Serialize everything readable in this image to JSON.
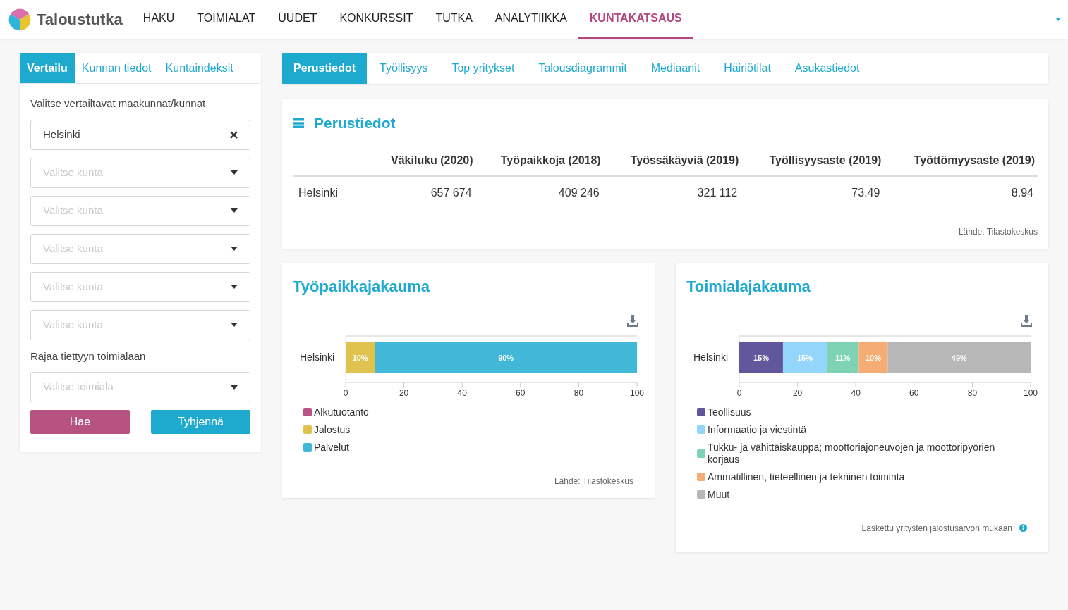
{
  "header": {
    "logo_text": "Taloustutka",
    "nav": [
      {
        "label": "HAKU",
        "selected": false
      },
      {
        "label": "TOIMIALAT",
        "selected": false
      },
      {
        "label": "UUDET",
        "selected": false
      },
      {
        "label": "KONKURSSIT",
        "selected": false
      },
      {
        "label": "TUTKA",
        "selected": false
      },
      {
        "label": "ANALYTIIKKA",
        "selected": false
      },
      {
        "label": "KUNTAKATSAUS",
        "selected": true
      }
    ]
  },
  "sidebar": {
    "tabs": [
      {
        "label": "Vertailu",
        "selected": true
      },
      {
        "label": "Kunnan tiedot",
        "selected": false
      },
      {
        "label": "Kuntaindeksit",
        "selected": false
      }
    ],
    "compare_label": "Valitse vertailtavat maakunnat/kunnat",
    "municipality_fields": [
      {
        "value": "Helsinki"
      },
      {
        "placeholder": "Valitse kunta"
      },
      {
        "placeholder": "Valitse kunta"
      },
      {
        "placeholder": "Valitse kunta"
      },
      {
        "placeholder": "Valitse kunta"
      },
      {
        "placeholder": "Valitse kunta"
      }
    ],
    "industry_label": "Rajaa tiettyyn toimialaan",
    "industry_field": {
      "placeholder": "Valitse toimiala"
    },
    "buttons": [
      {
        "label": "Hae",
        "kind": "primary"
      },
      {
        "label": "Tyhjennä",
        "kind": "secondary"
      }
    ]
  },
  "content_tabs": [
    {
      "label": "Perustiedot",
      "selected": true
    },
    {
      "label": "Työllisyys",
      "selected": false
    },
    {
      "label": "Top yritykset",
      "selected": false
    },
    {
      "label": "Talousdiagrammit",
      "selected": false
    },
    {
      "label": "Mediaanit",
      "selected": false
    },
    {
      "label": "Häiriötilat",
      "selected": false
    },
    {
      "label": "Asukastiedot",
      "selected": false
    }
  ],
  "basic_info": {
    "title": "Perustiedot",
    "table": {
      "columns": [
        "Väkiluku (2020)",
        "Työpaikkoja (2018)",
        "Työssäkäyviä (2019)",
        "Työllisyysaste (2019)",
        "Työttömyysaste (2019)"
      ],
      "rows": [
        {
          "name": "Helsinki",
          "cells": [
            "657 674",
            "409 246",
            "321 112",
            "73.49",
            "8.94"
          ]
        }
      ]
    },
    "source": "Lähde: Tilastokeskus"
  },
  "jobs_distribution": {
    "title": "Työpaikkajakauma",
    "chart_data": {
      "type": "bar",
      "orientation": "horizontal",
      "stacked": true,
      "categories": [
        "Helsinki"
      ],
      "series": [
        {
          "name": "Alkutuotanto",
          "color": "#b85486",
          "values": [
            0
          ],
          "value_labels": [
            null
          ]
        },
        {
          "name": "Jalostus",
          "color": "#e0c24f",
          "values": [
            10
          ],
          "value_labels": [
            "10%"
          ]
        },
        {
          "name": "Palvelut",
          "color": "#42b8d8",
          "values": [
            90
          ],
          "value_labels": [
            "90%"
          ]
        }
      ],
      "xlim": [
        0,
        100
      ],
      "xticks": [
        0,
        20,
        40,
        60,
        80,
        100
      ]
    },
    "source": "Lähde: Tilastokeskus"
  },
  "industry_distribution": {
    "title": "Toimialajakauma",
    "chart_data": {
      "type": "bar",
      "orientation": "horizontal",
      "stacked": true,
      "categories": [
        "Helsinki"
      ],
      "series": [
        {
          "name": "Teollisuus",
          "color": "#62569c",
          "values": [
            15
          ],
          "value_labels": [
            "15%"
          ]
        },
        {
          "name": "Informaatio ja viestintä",
          "color": "#94d5fb",
          "values": [
            15
          ],
          "value_labels": [
            "15%"
          ]
        },
        {
          "name": "Tukku- ja vähittäiskauppa; moottoriajoneuvojen ja moottoripyörien korjaus",
          "color": "#7dd3b4",
          "values": [
            11
          ],
          "value_labels": [
            "11%"
          ]
        },
        {
          "name": "Ammatillinen, tieteellinen ja tekninen toiminta",
          "color": "#f5ad75",
          "values": [
            10
          ],
          "value_labels": [
            "10%"
          ]
        },
        {
          "name": "Muut",
          "color": "#b7b7b7",
          "values": [
            49
          ],
          "value_labels": [
            "49%"
          ]
        }
      ],
      "xlim": [
        0,
        100
      ],
      "xticks": [
        0,
        20,
        40,
        60,
        80,
        100
      ]
    },
    "note": "Laskettu yritysten jalostusarvon mukaan"
  }
}
